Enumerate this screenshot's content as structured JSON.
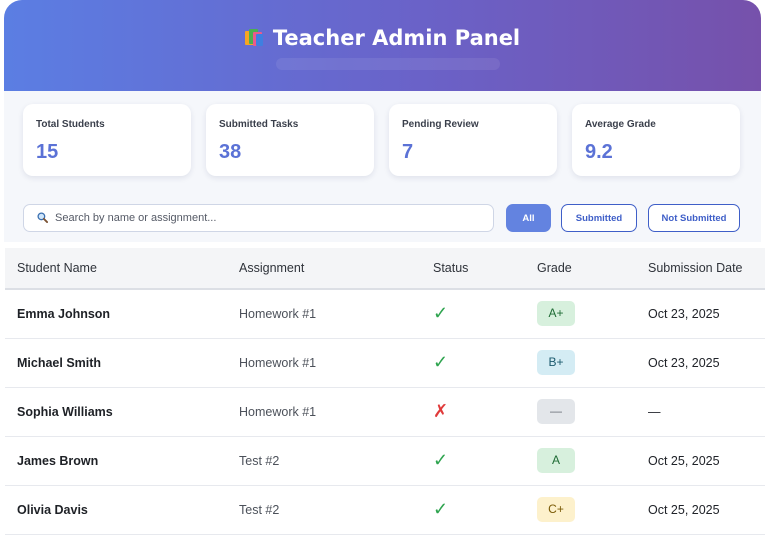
{
  "header": {
    "title": "Teacher Admin Panel",
    "icon": "books-icon"
  },
  "stats": [
    {
      "label": "Total Students",
      "value": "15"
    },
    {
      "label": "Submitted Tasks",
      "value": "38"
    },
    {
      "label": "Pending Review",
      "value": "7"
    },
    {
      "label": "Average Grade",
      "value": "9.2"
    }
  ],
  "search": {
    "placeholder": "Search by name or assignment...",
    "value": "",
    "icon": "search-icon"
  },
  "filters": {
    "all": "All",
    "submitted": "Submitted",
    "not_submitted": "Not Submitted",
    "selected": "All"
  },
  "table": {
    "columns": [
      "Student Name",
      "Assignment",
      "Status",
      "Grade",
      "Submission Date"
    ],
    "rows": [
      {
        "name": "Emma Johnson",
        "assignment": "Homework #1",
        "status": "✓",
        "grade": "A+",
        "date": "Oct 23, 2025"
      },
      {
        "name": "Michael Smith",
        "assignment": "Homework #1",
        "status": "✓",
        "grade": "B+",
        "date": "Oct 23, 2025"
      },
      {
        "name": "Sophia Williams",
        "assignment": "Homework #1",
        "status": "✗",
        "grade": "—",
        "date": "—"
      },
      {
        "name": "James Brown",
        "assignment": "Test #2",
        "status": "✓",
        "grade": "A",
        "date": "Oct 25, 2025"
      },
      {
        "name": "Olivia Davis",
        "assignment": "Test #2",
        "status": "✓",
        "grade": "C+",
        "date": "Oct 25, 2025"
      }
    ]
  },
  "colors": {
    "header_start": "#5b7ee3",
    "header_end": "#7651ab",
    "accent": "#5b72d6",
    "grade_a_bg": "#d7f0dd",
    "grade_a_fg": "#1e6b34",
    "grade_b_bg": "#d4ecf4",
    "grade_b_fg": "#1c5a6e",
    "grade_c_bg": "#fdf1cc",
    "grade_c_fg": "#7a5a05",
    "grade_none_bg": "#e3e6ea",
    "grade_none_fg": "#6b7078"
  }
}
